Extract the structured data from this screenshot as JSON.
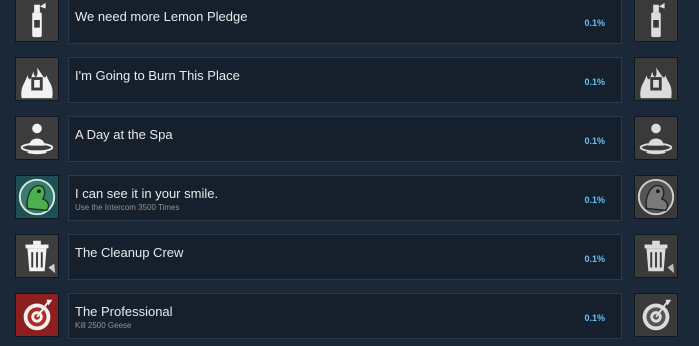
{
  "achievements": [
    {
      "title": "We need more Lemon Pledge",
      "description": "",
      "percent": "0.1%",
      "icon": "spray-can-icon",
      "unlocked_color": "#3d3d3d"
    },
    {
      "title": "I'm Going to Burn This Place",
      "description": "",
      "percent": "0.1%",
      "icon": "fire-icon",
      "unlocked_color": "#3d3d3d"
    },
    {
      "title": "A Day at the Spa",
      "description": "",
      "percent": "0.1%",
      "icon": "spa-icon",
      "unlocked_color": "#3d3d3d"
    },
    {
      "title": "I can see it in your smile.",
      "description": "Use the Intercom 3500 Times",
      "percent": "0.1%",
      "icon": "goose-face-icon",
      "unlocked_color": "#2e7d6b"
    },
    {
      "title": "The Cleanup Crew",
      "description": "",
      "percent": "0.1%",
      "icon": "trash-can-icon",
      "unlocked_color": "#3d3d3d"
    },
    {
      "title": "The Professional",
      "description": "Kill 2500 Geese",
      "percent": "0.1%",
      "icon": "target-icon",
      "unlocked_color": "#b02a2a"
    }
  ],
  "colors": {
    "background": "#1b2838",
    "panel": "#16202d",
    "percent_text": "#66c0f4",
    "title_text": "#e7e9eb",
    "desc_text": "#8b929a"
  }
}
